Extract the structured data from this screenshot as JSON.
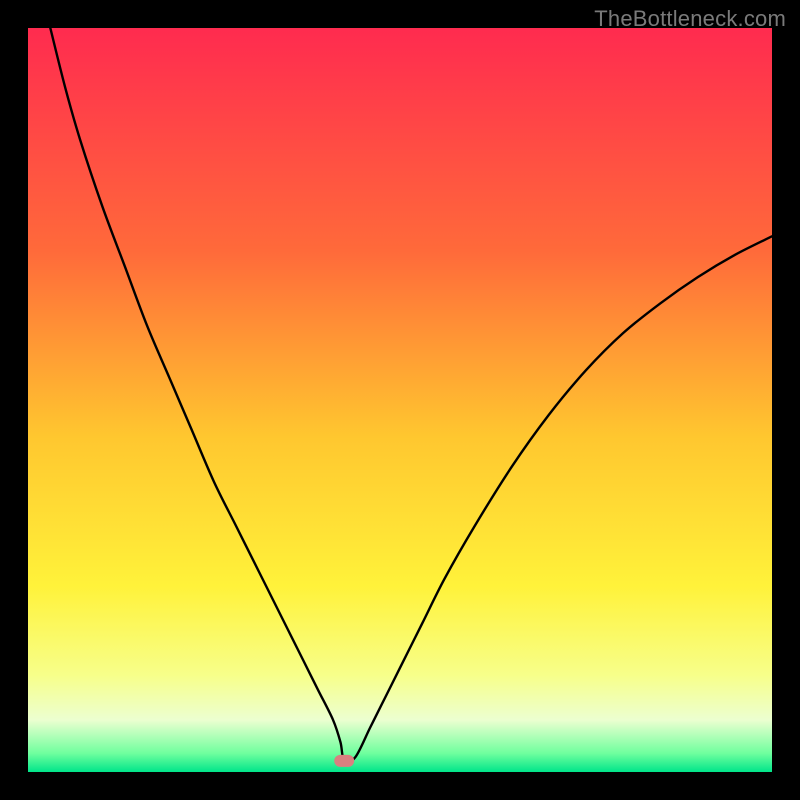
{
  "watermark": "TheBottleneck.com",
  "chart_data": {
    "type": "line",
    "title": "",
    "xlabel": "",
    "ylabel": "",
    "xlim": [
      0,
      100
    ],
    "ylim": [
      0,
      100
    ],
    "x": [
      3,
      5,
      7,
      10,
      13,
      16,
      19,
      22,
      25,
      28,
      31,
      33,
      35,
      37,
      39,
      41,
      42,
      42.5,
      44,
      46,
      48,
      50,
      53,
      56,
      60,
      65,
      70,
      75,
      80,
      85,
      90,
      95,
      100
    ],
    "y": [
      100,
      92,
      85,
      76,
      68,
      60,
      53,
      46,
      39,
      33,
      27,
      23,
      19,
      15,
      11,
      7,
      4,
      1.5,
      2,
      6,
      10,
      14,
      20,
      26,
      33,
      41,
      48,
      54,
      59,
      63,
      66.5,
      69.5,
      72
    ],
    "optimum_marker": {
      "x": 42.5,
      "y": 1.5
    },
    "gradient_stops": [
      {
        "offset": 0.0,
        "color": "#ff2b4f"
      },
      {
        "offset": 0.3,
        "color": "#ff6a3a"
      },
      {
        "offset": 0.55,
        "color": "#ffc72f"
      },
      {
        "offset": 0.75,
        "color": "#fff23a"
      },
      {
        "offset": 0.87,
        "color": "#f7ff8a"
      },
      {
        "offset": 0.93,
        "color": "#ecffd0"
      },
      {
        "offset": 0.975,
        "color": "#6fff9e"
      },
      {
        "offset": 1.0,
        "color": "#00e58a"
      }
    ]
  }
}
